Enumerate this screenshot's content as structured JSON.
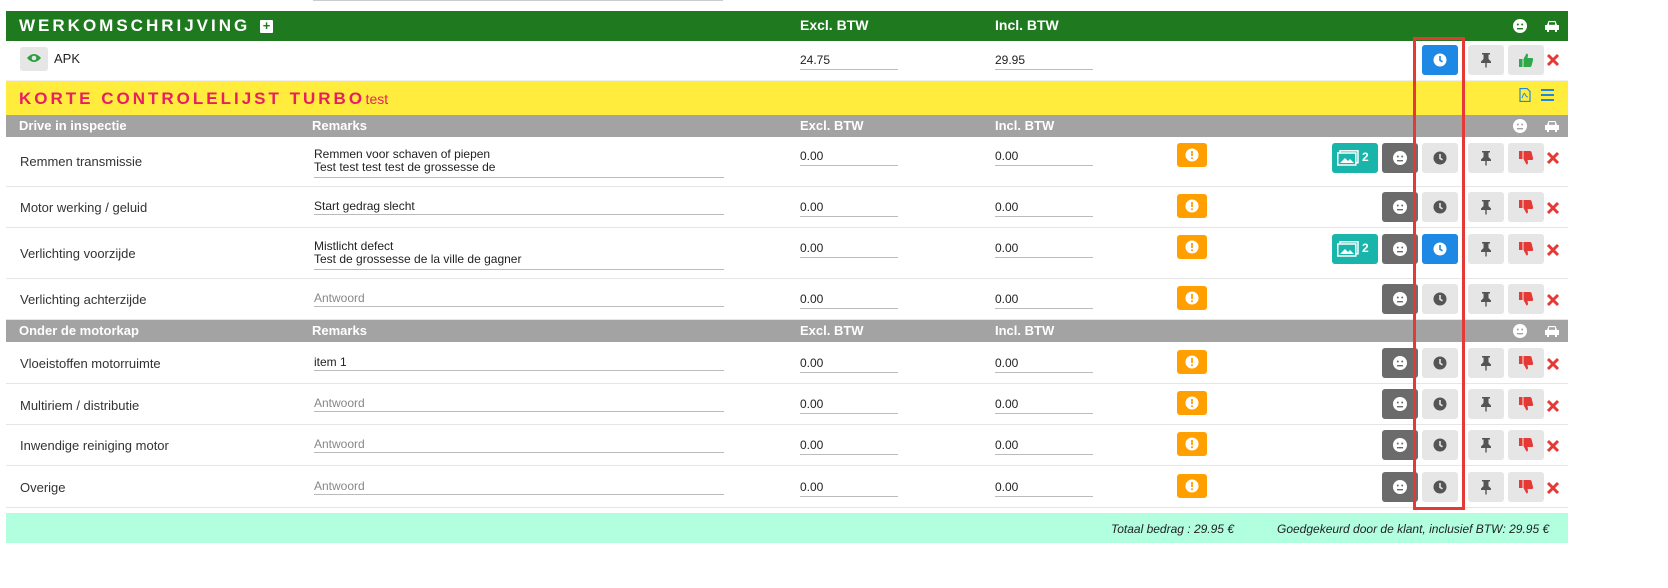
{
  "werkomschrijving": {
    "title": "WERKOMSCHRIJVING",
    "col_excl": "Excl. BTW",
    "col_incl": "Incl. BTW",
    "apk": {
      "label": "APK",
      "excl": "24.75",
      "incl": "29.95"
    }
  },
  "checklist": {
    "title": "KORTE CONTROLELIJST TURBO",
    "subtitle": "- test"
  },
  "sections": [
    {
      "title": "Drive in inspectie",
      "col_remarks": "Remarks",
      "col_excl": "Excl. BTW",
      "col_incl": "Incl. BTW",
      "rows": [
        {
          "label": "Remmen transmissie",
          "remark1": "Remmen voor schaven of piepen",
          "remark2": "Test test test test de grossesse de",
          "excl": "0.00",
          "incl": "0.00",
          "photos": "2"
        },
        {
          "label": "Motor werking / geluid",
          "remark1": "Start gedrag slecht",
          "excl": "0.00",
          "incl": "0.00"
        },
        {
          "label": "Verlichting voorzijde",
          "remark1": "Mistlicht defect",
          "remark2": "Test de grossesse de la ville de gagner",
          "excl": "0.00",
          "incl": "0.00",
          "photos": "2"
        },
        {
          "label": "Verlichting achterzijde",
          "placeholder": "Antwoord",
          "excl": "0.00",
          "incl": "0.00"
        }
      ]
    },
    {
      "title": "Onder de motorkap",
      "col_remarks": "Remarks",
      "col_excl": "Excl. BTW",
      "col_incl": "Incl. BTW",
      "rows": [
        {
          "label": "Vloeistoffen motorruimte",
          "remark1": "item 1",
          "excl": "0.00",
          "incl": "0.00"
        },
        {
          "label": "Multiriem / distributie",
          "placeholder": "Antwoord",
          "excl": "0.00",
          "incl": "0.00"
        },
        {
          "label": "Inwendige reiniging motor",
          "placeholder": "Antwoord",
          "excl": "0.00",
          "incl": "0.00"
        },
        {
          "label": "Overige",
          "placeholder": "Antwoord",
          "excl": "0.00",
          "incl": "0.00"
        }
      ]
    }
  ],
  "footer": {
    "total": "Totaal bedrag : 29.95 €",
    "approved": "Goedgekeurd door de klant, inclusief BTW: 29.95 €"
  },
  "icons": {
    "clock": "clock-icon",
    "pin": "pin-icon",
    "thumbs_up": "thumbs-up-icon",
    "thumbs_down": "thumbs-down-icon",
    "close": "close-icon",
    "eye": "eye-icon",
    "smiley": "smiley-icon",
    "car": "car-icon",
    "images": "images-icon",
    "warning": "warning-icon",
    "pdf": "pdf-icon",
    "menu": "menu-icon",
    "plus": "plus-icon"
  },
  "colors": {
    "green_header": "#1f7a1f",
    "yellow_header": "#ffec3d",
    "pink_title": "#e81e63",
    "grey_header": "#a3a3a3",
    "blue_button": "#1e88e5",
    "teal_button": "#19b5aa",
    "orange_warning": "#ffa000",
    "red_action": "#e53935",
    "footer_bg": "#b2ffe0",
    "highlight": "#e53935"
  }
}
